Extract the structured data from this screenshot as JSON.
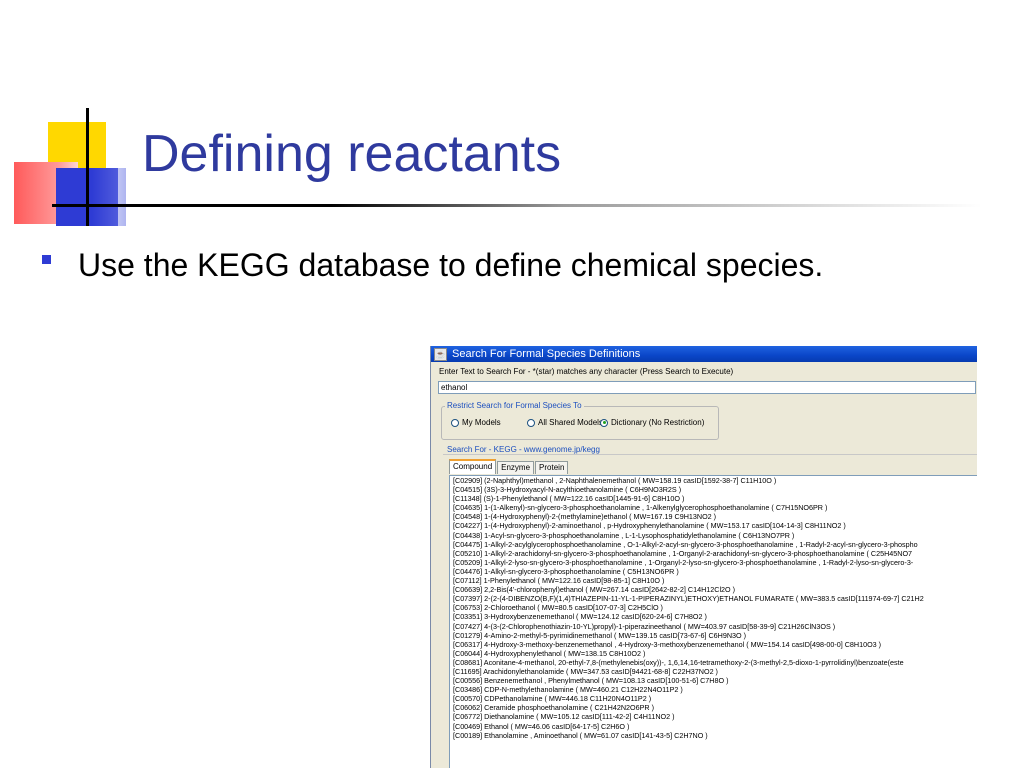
{
  "slide": {
    "title": "Defining reactants",
    "bullet": "Use the KEGG database to define chemical species."
  },
  "window": {
    "title": "Search For Formal Species Definitions",
    "instruction": "Enter Text to Search For - *(star) matches any character  (Press  Search to Execute)",
    "search_value": "ethanol",
    "restrict_legend": "Restrict Search for Formal Species To",
    "radios": [
      {
        "label": "My Models",
        "selected": false
      },
      {
        "label": "All Shared Models",
        "selected": false
      },
      {
        "label": "Dictionary (No Restriction)",
        "selected": true
      }
    ],
    "search_for": "Search For - KEGG - www.genome.jp/kegg",
    "tabs": [
      "Compound",
      "Enzyme",
      "Protein"
    ],
    "active_tab": "Compound",
    "results": [
      "[C02909]  (2-Naphthyl)methanol , 2-Naphthalenemethanol   ( MW=158.19  casID[1592-38-7]  C11H10O )",
      "[C04515]  (3S)-3-Hydroxyacyl-N-acylthioethanolamine   ( C6H9NO3R2S )",
      "[C11348]  (S)-1-Phenylethanol   ( MW=122.16  casID[1445-91-6]  C8H10O )",
      "[C04635]  1-(1-Alkenyl)-sn-glycero-3-phosphoethanolamine , 1-Alkenylglycerophosphoethanolamine   ( C7H15NO6PR )",
      "[C04548]  1-(4-Hydroxyphenyl)-2-(methylamine)ethanol   ( MW=167.19  C9H13NO2 )",
      "[C04227]  1-(4-Hydroxyphenyl)-2-aminoethanol , p-Hydroxyphenylethanolamine   ( MW=153.17  casID[104-14-3]  C8H11NO2 )",
      "[C04438]  1-Acyl-sn-glycero-3-phosphoethanolamine , L-1-Lysophosphatidylethanolamine   ( C6H13NO7PR )",
      "[C04475]  1-Alkyl-2-acylglycerophosphoethanolamine , O-1-Alkyl-2-acyl-sn-glycero-3-phosphoethanolamine , 1-Radyl-2-acyl-sn-glycero-3-phospho",
      "[C05210]  1-Alkyl-2-arachidonyl-sn-glycero-3-phosphoethanolamine , 1-Organyl-2-arachidonyl-sn-glycero-3-phosphoethanolamine   ( C25H45NO7",
      "[C05209]  1-Alkyl-2-lyso-sn-glycero-3-phosphoethanolamine , 1-Organyl-2-lyso-sn-glycero-3-phosphoethanolamine , 1-Radyl-2-lyso-sn-glycero-3-",
      "[C04476]  1-Alkyl-sn-glycero-3-phosphoethanolamine   ( C5H13NO6PR )",
      "[C07112]  1-Phenylethanol   ( MW=122.16  casID[98-85-1]  C8H10O )",
      "[C06639]  2,2-Bis(4'-chlorophenyl)ethanol   ( MW=267.14  casID[2642-82-2]  C14H12Cl2O )",
      "[C07397]  2-(2-(4-DIBENZO(B,F)(1,4)THIAZEPIN-11-YL-1-PIPERAZINYL)ETHOXY)ETHANOL FUMARATE   ( MW=383.5  casID[111974-69-7]  C21H2",
      "[C06753]  2-Chloroethanol   ( MW=80.5  casID[107-07-3]  C2H5ClO )",
      "[C03351]  3-Hydroxybenzenemethanol   ( MW=124.12  casID[620-24-6]  C7H8O2 )",
      "[C07427]  4-(3-(2-Chlorophenothiazin-10-YL)propyl)-1-piperazineethanol   ( MW=403.97  casID[58-39-9]  C21H26ClN3OS )",
      "[C01279]  4-Amino-2-methyl-5-pyrimidinemethanol   ( MW=139.15  casID[73-67-6]  C6H9N3O )",
      "[C06317]  4-Hydroxy-3-methoxy-benzenemethanol , 4-Hydroxy-3-methoxybenzenemethanol   ( MW=154.14  casID[498-00-0]  C8H10O3 )",
      "[C06044]  4-Hydroxyphenylethanol   ( MW=138.15  C8H10O2 )",
      "[C08681]  Aconitane-4-methanol, 20-ethyl-7,8-(methylenebis(oxy))-, 1,6,14,16-tetramethoxy-2-(3-methyl-2,5-dioxo-1-pyrrolidinyl)benzoate(este",
      "[C11695]  Arachidonylethanolamide   ( MW=347.53  casID[94421-68-8]  C22H37NO2 )",
      "[C00556]  Benzenemethanol , Phenylmethanol   ( MW=108.13  casID[100-51-6]  C7H8O )",
      "[C03486]  CDP-N-methylethanolamine   ( MW=460.21  C12H22N4O11P2 )",
      "[C00570]  CDPethanolamine   ( MW=446.18  C11H20N4O11P2 )",
      "[C06062]  Ceramide phosphoethanolamine   ( C21H42N2O6PR )",
      "[C06772]  Diethanolamine   ( MW=105.12  casID[111-42-2]  C4H11NO2 )",
      "[C00469]  Ethanol   ( MW=46.06  casID[64-17-5]  C2H6O )",
      "[C00189]  Ethanolamine , Aminoethanol   ( MW=61.07  casID[141-43-5]  C2H7NO )"
    ]
  }
}
